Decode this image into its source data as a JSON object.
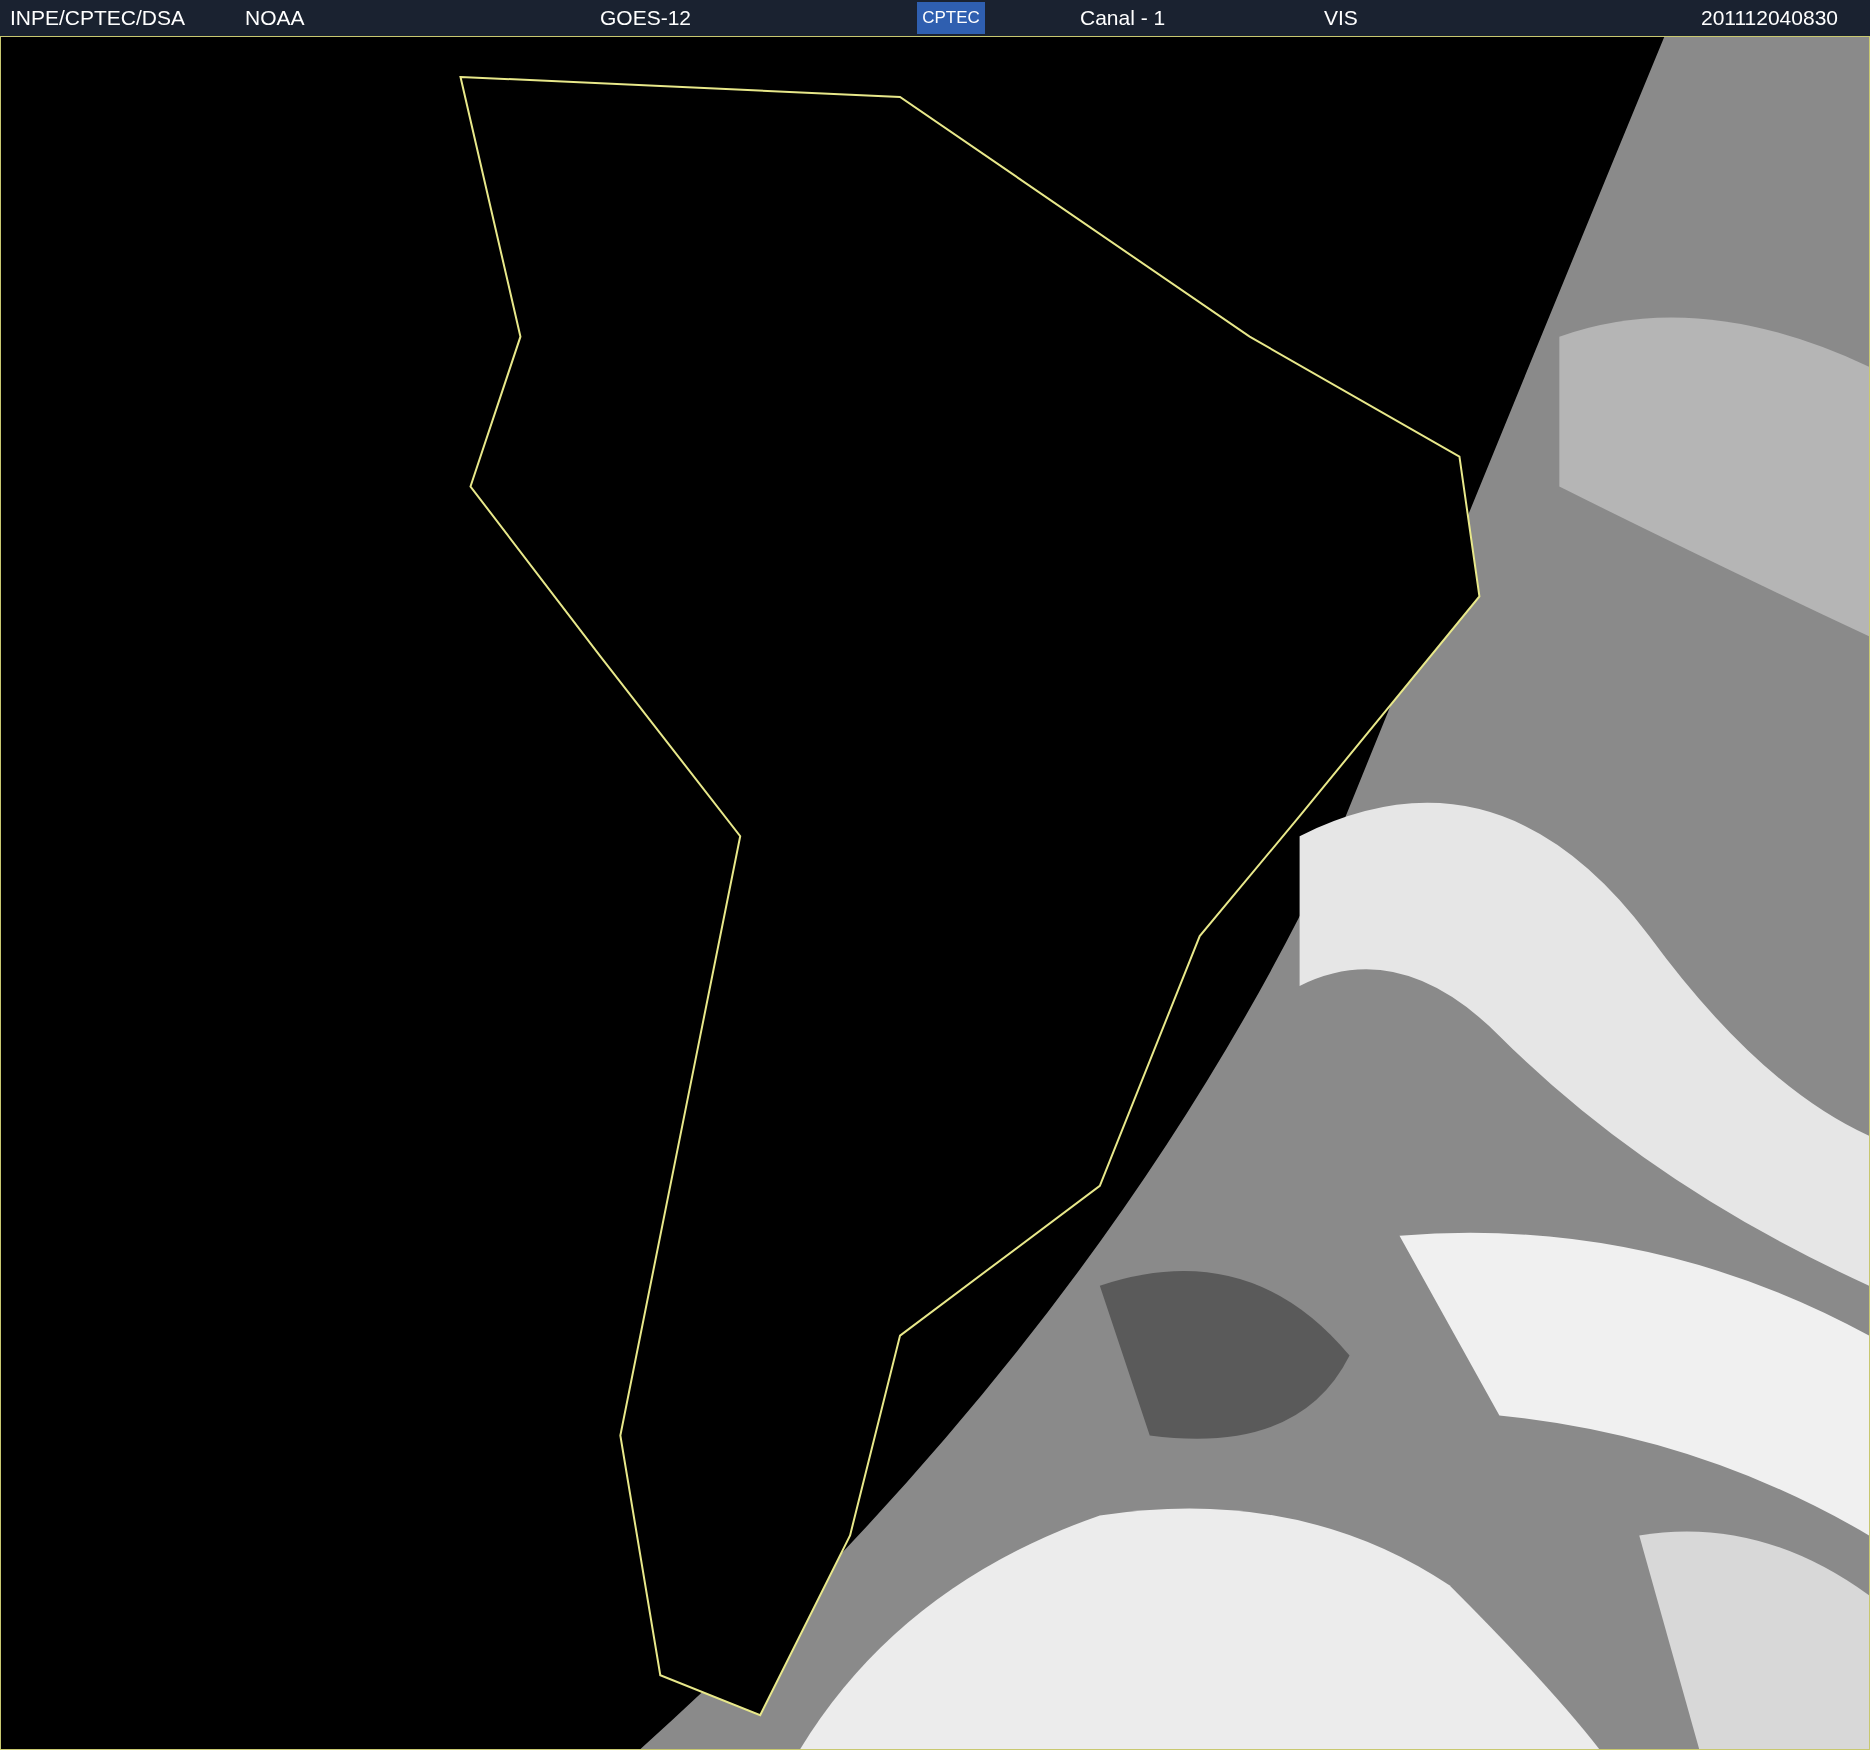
{
  "header": {
    "items": [
      "INPE/CPTEC/DSA",
      "NOAA",
      "GOES-12"
    ],
    "logo": "CPTEC",
    "channel": "Canal - 1",
    "band": "VIS",
    "timestamp": "201112040830"
  }
}
